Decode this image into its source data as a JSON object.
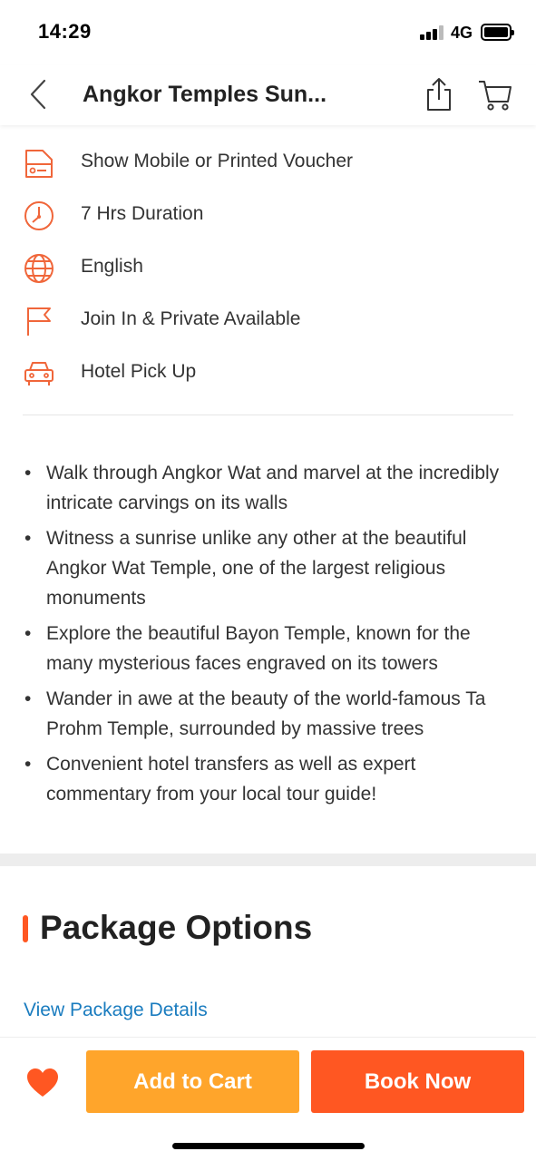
{
  "status_bar": {
    "time": "14:29",
    "network": "4G"
  },
  "nav": {
    "title": "Angkor Temples Sun...",
    "back_icon": "chevron-left-icon",
    "share_icon": "share-icon",
    "cart_icon": "cart-icon"
  },
  "info": [
    {
      "icon": "voucher-icon",
      "label": "Show Mobile or Printed Voucher"
    },
    {
      "icon": "clock-icon",
      "label": "7 Hrs Duration"
    },
    {
      "icon": "globe-icon",
      "label": "English"
    },
    {
      "icon": "flag-icon",
      "label": "Join In & Private Available"
    },
    {
      "icon": "car-icon",
      "label": "Hotel Pick Up"
    }
  ],
  "highlights": [
    "Walk through Angkor Wat and marvel at the incredibly intricate carvings on its walls",
    "Witness a sunrise unlike any other at the beautiful Angkor Wat Temple, one of the largest religious monuments",
    "Explore the beautiful Bayon Temple, known for the many mysterious faces engraved on its towers",
    "Wander in awe at the beauty of the world-famous Ta Prohm Temple, surrounded by massive trees",
    "Convenient hotel transfers as well as expert commentary from your local tour guide!"
  ],
  "packages": {
    "title": "Package Options",
    "link_label": "View Package Details"
  },
  "bottom": {
    "wishlist_icon": "heart-icon",
    "add_to_cart_label": "Add to Cart",
    "book_now_label": "Book Now"
  },
  "colors": {
    "accent": "#ff5722",
    "cart_button": "#ffa52b",
    "link": "#1a7cbf",
    "icon": "#f0663a"
  }
}
